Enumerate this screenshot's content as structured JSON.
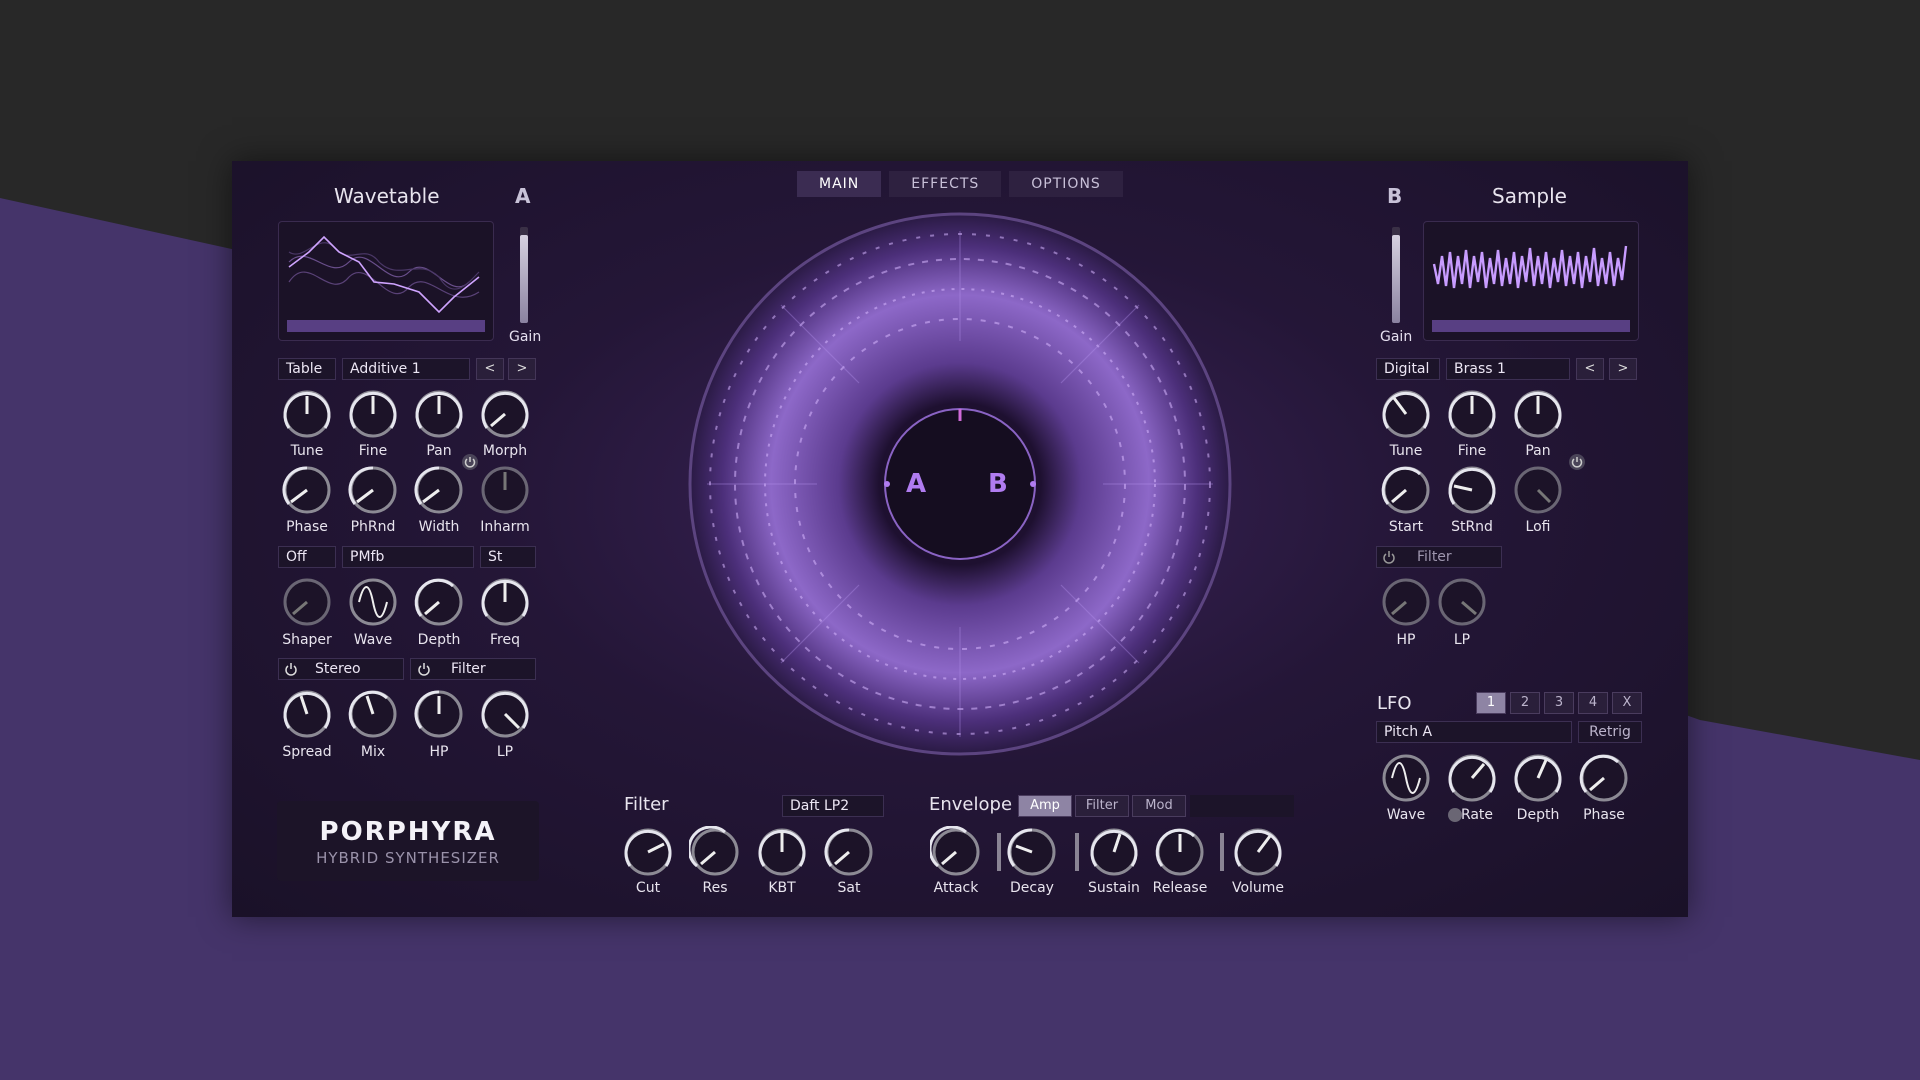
{
  "tabs": [
    "MAIN",
    "EFFECTS",
    "OPTIONS"
  ],
  "osc_a": {
    "title": "Wavetable",
    "letter": "A",
    "gain_label": "Gain",
    "table_label": "Table",
    "table_value": "Additive 1",
    "prev": "<",
    "next": ">",
    "knobs_row1": [
      "Tune",
      "Fine",
      "Pan",
      "Morph"
    ],
    "knobs_row2": [
      "Phase",
      "PhRnd",
      "Width",
      "Inharm"
    ],
    "mod_mode": "Off",
    "mod_type": "PMfb",
    "mod_st": "St",
    "knobs_row3": [
      "Shaper",
      "Wave",
      "Depth",
      "Freq"
    ],
    "stereo_label": "Stereo",
    "filter_label": "Filter",
    "knobs_row4": [
      "Spread",
      "Mix",
      "HP",
      "LP"
    ]
  },
  "osc_b": {
    "title": "Sample",
    "letter": "B",
    "gain_label": "Gain",
    "mode_value": "Digital",
    "sample_value": "Brass 1",
    "prev": "<",
    "next": ">",
    "knobs_row1": [
      "Tune",
      "Fine",
      "Pan"
    ],
    "knobs_row2": [
      "Start",
      "StRnd",
      "Lofi"
    ],
    "filter_label": "Filter",
    "knobs_row3": [
      "HP",
      "LP"
    ]
  },
  "lfo": {
    "title": "LFO",
    "slots": [
      "1",
      "2",
      "3",
      "4",
      "X"
    ],
    "target": "Pitch A",
    "retrig": "Retrig",
    "knobs": [
      "Wave",
      "Rate",
      "Depth",
      "Phase"
    ]
  },
  "center": {
    "a": "A",
    "b": "B"
  },
  "filter": {
    "title": "Filter",
    "type": "Daft LP2",
    "knobs": [
      "Cut",
      "Res",
      "KBT",
      "Sat"
    ]
  },
  "envelope": {
    "title": "Envelope",
    "tabs": [
      "Amp",
      "Filter",
      "Mod"
    ],
    "knobs": [
      "Attack",
      "Decay",
      "Sustain",
      "Release",
      "Volume"
    ]
  },
  "logo": {
    "name": "PORPHYRA",
    "sub": "HYBRID SYNTHESIZER"
  },
  "colors": {
    "accent": "#a47be0",
    "panel": "#241637",
    "background": "#282828",
    "stripe": "#45346a"
  },
  "icons": [
    "power-icon",
    "sine-wave-icon",
    "chevron-left-icon",
    "chevron-right-icon"
  ]
}
